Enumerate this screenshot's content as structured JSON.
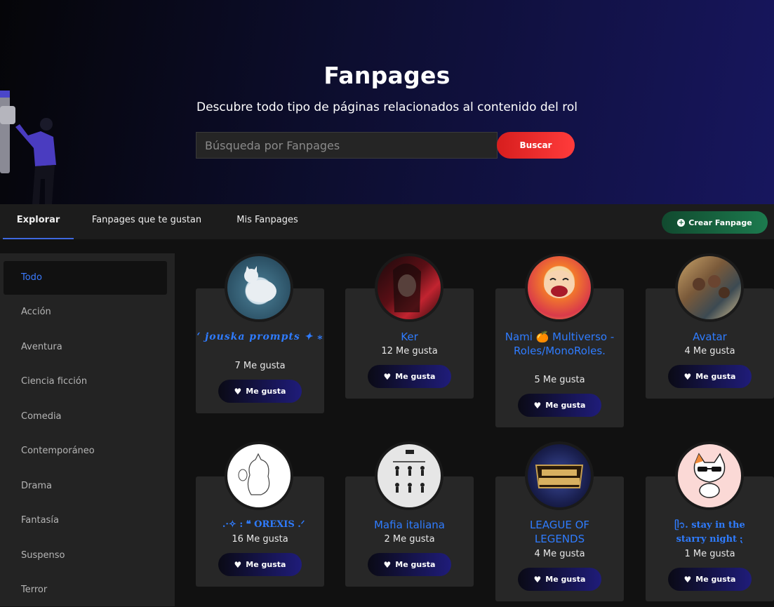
{
  "hero": {
    "title": "Fanpages",
    "subtitle": "Descubre todo tipo de páginas relacionados al contenido del rol",
    "search_placeholder": "Búsqueda por Fanpages",
    "search_button": "Buscar"
  },
  "tabs": [
    {
      "label": "Explorar",
      "active": true
    },
    {
      "label": "Fanpages que te gustan",
      "active": false
    },
    {
      "label": "Mis Fanpages",
      "active": false
    }
  ],
  "create_button": "Crear Fanpage",
  "sidebar": {
    "items": [
      {
        "label": "Todo",
        "active": true
      },
      {
        "label": "Acción"
      },
      {
        "label": "Aventura"
      },
      {
        "label": "Ciencia ficción"
      },
      {
        "label": "Comedia"
      },
      {
        "label": "Contemporáneo"
      },
      {
        "label": "Drama"
      },
      {
        "label": "Fantasía"
      },
      {
        "label": "Suspenso"
      },
      {
        "label": "Terror"
      }
    ]
  },
  "cards": [
    {
      "name": "‘ jouska prompts ✦ ⁎",
      "likes": "7 Me gusta",
      "button": "Me gusta",
      "avatar": "cat-sleeping-icon"
    },
    {
      "name": "Ker",
      "likes": "12 Me gusta",
      "button": "Me gusta",
      "avatar": "dark-haired-girl-icon"
    },
    {
      "name": "Nami 🍊 Multiverso - Roles/MonoRoles.",
      "likes": "5 Me gusta",
      "button": "Me gusta",
      "avatar": "nami-laughing-icon"
    },
    {
      "name": "Avatar",
      "likes": "4 Me gusta",
      "button": "Me gusta",
      "avatar": "avatar-group-icon"
    },
    {
      "name": "⠀.·✧ : ❝ OREXIS .ᐟ",
      "likes": "16 Me gusta",
      "button": "Me gusta",
      "avatar": "cat-sketch-icon"
    },
    {
      "name": "Mafia italiana",
      "likes": "2 Me gusta",
      "button": "Me gusta",
      "avatar": "family-tree-icon"
    },
    {
      "name": "LEAGUE OF LEGENDS",
      "likes": "4 Me gusta",
      "button": "Me gusta",
      "avatar": "lol-logo-icon"
    },
    {
      "name": "ᥫ᭡. stay in the starry night ⁏",
      "likes": "1 Me gusta",
      "button": "Me gusta",
      "avatar": "cool-cat-icon"
    }
  ],
  "colors": {
    "accent_blue": "#2f7cff",
    "search_red": "#e02424",
    "create_green": "#1c7a4e",
    "hero_navy": "#17165e"
  }
}
